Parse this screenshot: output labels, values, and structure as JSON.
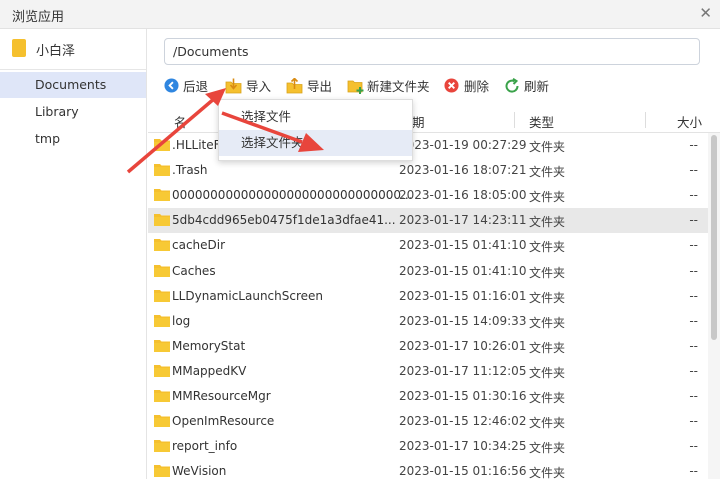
{
  "window": {
    "title": "浏览应用"
  },
  "sidebar": {
    "app_name": "小白泽",
    "items": [
      {
        "label": "Documents"
      },
      {
        "label": "Library"
      },
      {
        "label": "tmp"
      }
    ]
  },
  "path": {
    "value": "/Documents"
  },
  "toolbar": {
    "back": "后退",
    "import": "导入",
    "export": "导出",
    "new_folder": "新建文件夹",
    "delete": "删除",
    "refresh": "刷新"
  },
  "dropdown": {
    "items": [
      {
        "label": "选择文件"
      },
      {
        "label": "选择文件夹"
      }
    ]
  },
  "table": {
    "columns": {
      "name": "名称",
      "date": "日期",
      "type": "类型",
      "size": "大小"
    },
    "col_name_visible": "名",
    "col_date_visible": "期",
    "rows": [
      {
        "name": ".HLLiteFi",
        "date": "2023-01-19 00:27:29",
        "type": "文件夹",
        "size": "--"
      },
      {
        "name": ".Trash",
        "date": "2023-01-16 18:07:21",
        "type": "文件夹",
        "size": "--"
      },
      {
        "name": "000000000000000000000000000000...",
        "date": "2023-01-16 18:05:00",
        "type": "文件夹",
        "size": "--"
      },
      {
        "name": "5db4cdd965eb0475f1de1a3dfae41...",
        "date": "2023-01-17 14:23:11",
        "type": "文件夹",
        "size": "--"
      },
      {
        "name": "cacheDir",
        "date": "2023-01-15 01:41:10",
        "type": "文件夹",
        "size": "--"
      },
      {
        "name": "Caches",
        "date": "2023-01-15 01:41:10",
        "type": "文件夹",
        "size": "--"
      },
      {
        "name": "LLDynamicLaunchScreen",
        "date": "2023-01-15 01:16:01",
        "type": "文件夹",
        "size": "--"
      },
      {
        "name": "log",
        "date": "2023-01-15 14:09:33",
        "type": "文件夹",
        "size": "--"
      },
      {
        "name": "MemoryStat",
        "date": "2023-01-17 10:26:01",
        "type": "文件夹",
        "size": "--"
      },
      {
        "name": "MMappedKV",
        "date": "2023-01-17 11:12:05",
        "type": "文件夹",
        "size": "--"
      },
      {
        "name": "MMResourceMgr",
        "date": "2023-01-15 01:30:16",
        "type": "文件夹",
        "size": "--"
      },
      {
        "name": "OpenImResource",
        "date": "2023-01-15 12:46:02",
        "type": "文件夹",
        "size": "--"
      },
      {
        "name": "report_info",
        "date": "2023-01-17 10:34:25",
        "type": "文件夹",
        "size": "--"
      },
      {
        "name": "WeVision",
        "date": "2023-01-15 01:16:56",
        "type": "文件夹",
        "size": "--"
      }
    ]
  },
  "colors": {
    "accent": "#e8453c",
    "folder": "#f5c02e",
    "selection": "#dfe6f8"
  }
}
